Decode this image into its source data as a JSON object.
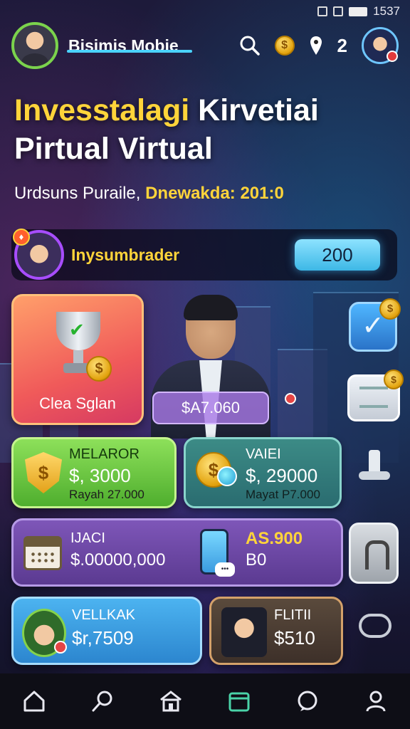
{
  "status_bar": {
    "time": "1537"
  },
  "header": {
    "app_name": "Bisimis Mobie",
    "notification_count": "2",
    "icons": [
      "search-icon",
      "coin-icon",
      "location-icon"
    ]
  },
  "hero": {
    "title_highlight": "Invesstalagi",
    "title_rest": " Kirvetiai",
    "title_line2": "Pirtual Virtual",
    "subtitle_prefix": "Urdsuns Puraile, ",
    "subtitle_highlight": "Dnewakda: 201:0"
  },
  "user_row": {
    "username": "Inysumbrader",
    "points": "200"
  },
  "trophy_card": {
    "label": "Clea Sglan"
  },
  "balance_badge": {
    "value": "$A7.060"
  },
  "cards": {
    "green": {
      "label": "MELAROR",
      "value": "$, 3000",
      "sub": "Rayah 27.000"
    },
    "teal": {
      "label": "VAIEI",
      "value": "$, 29000",
      "sub": "Mayat P7.000"
    },
    "purple": {
      "left_label": "IJACI",
      "left_value": "$.00000,000",
      "right_label": "AS.900",
      "right_value": "B0"
    },
    "blue": {
      "label": "VELLKAK",
      "value": "$r,7509"
    },
    "brown": {
      "label": "FLITII",
      "value": "$510"
    }
  },
  "colors": {
    "accent_gold": "#ffd43a",
    "accent_cyan": "#4ad3ff",
    "active_nav": "#4ad3a8"
  },
  "bottom_nav": [
    "home-icon",
    "search-icon",
    "store-icon",
    "calendar-icon",
    "chat-icon",
    "profile-icon"
  ]
}
